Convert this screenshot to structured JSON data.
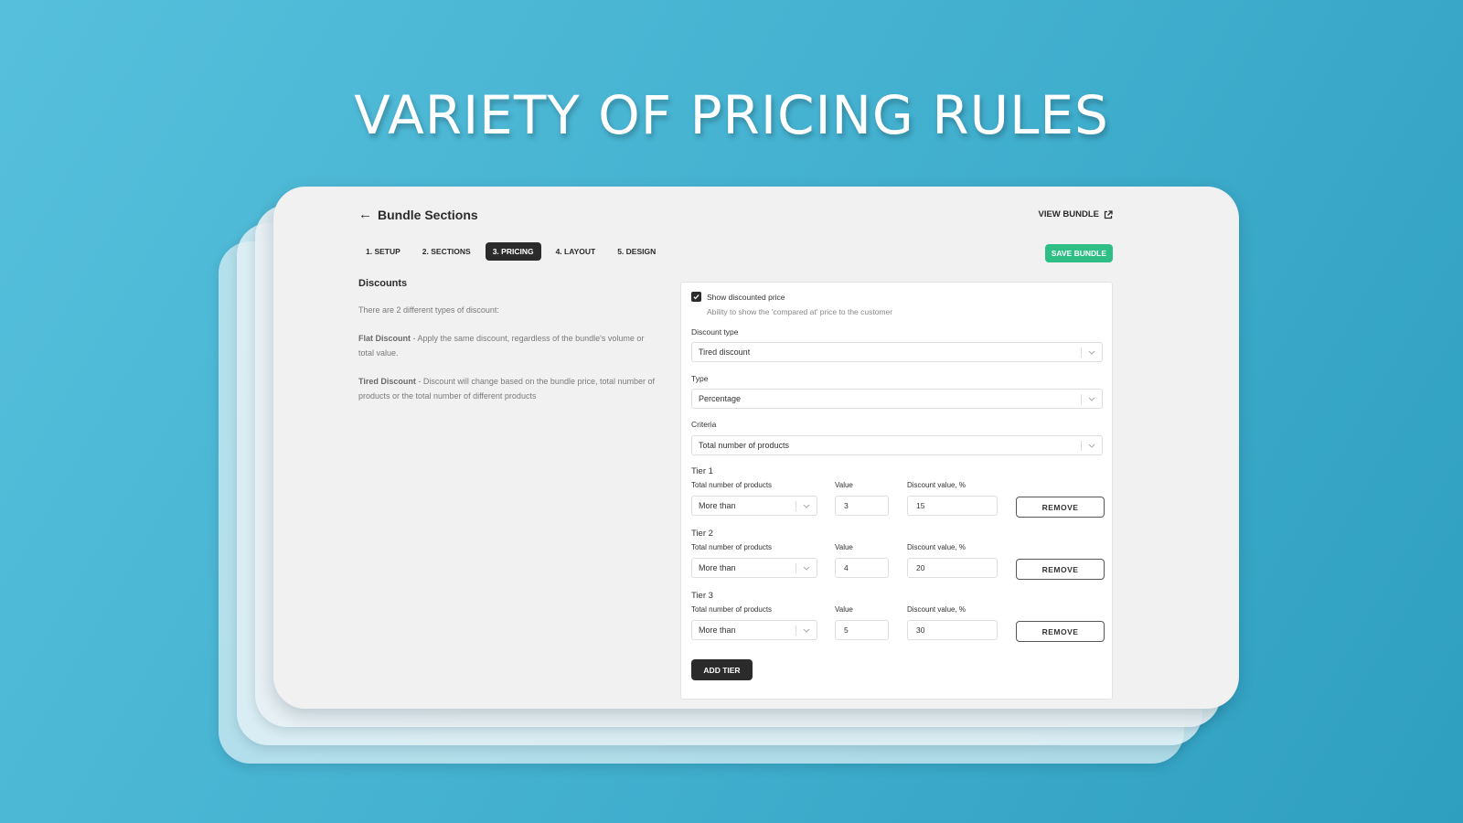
{
  "hero": {
    "title": "VARIETY OF PRICING RULES"
  },
  "header": {
    "back_icon": "arrow-left-icon",
    "title": "Bundle Sections",
    "view_bundle_label": "VIEW BUNDLE",
    "view_bundle_icon": "external-link-icon"
  },
  "tabs": [
    {
      "label": "1. SETUP",
      "active": false
    },
    {
      "label": "2. SECTIONS",
      "active": false
    },
    {
      "label": "3. PRICING",
      "active": true
    },
    {
      "label": "4. LAYOUT",
      "active": false
    },
    {
      "label": "5. DESIGN",
      "active": false
    }
  ],
  "save_label": "SAVE BUNDLE",
  "colors": {
    "save_button": "#2fbf86",
    "active_tab": "#2b2b2b",
    "background": "#45b2d1"
  },
  "info": {
    "heading": "Discounts",
    "intro": "There are 2 different types of discount:",
    "flat_title": "Flat Discount",
    "flat_text": " - Apply the same discount, regardless of the bundle's volume or total value.",
    "tiered_title": "Tired Discount",
    "tiered_text": " - Discount will change based on the bundle price, total number of products or the total number of different products"
  },
  "form": {
    "show_discounted": {
      "label": "Show discounted price",
      "help": "Ability to show the 'compared at' price to the customer",
      "checked": true
    },
    "discount_type": {
      "label": "Discount type",
      "value": "Tired discount"
    },
    "type": {
      "label": "Type",
      "value": "Percentage"
    },
    "criteria": {
      "label": "Criteria",
      "value": "Total number of products"
    },
    "tiers": [
      {
        "title": "Tier 1",
        "criteria_label": "Total number of products",
        "operator": "More than",
        "value_label": "Value",
        "value": "3",
        "discount_label": "Discount value, %",
        "discount": "15",
        "remove_label": "REMOVE"
      },
      {
        "title": "Tier 2",
        "criteria_label": "Total number of products",
        "operator": "More than",
        "value_label": "Value",
        "value": "4",
        "discount_label": "Discount value, %",
        "discount": "20",
        "remove_label": "REMOVE"
      },
      {
        "title": "Tier 3",
        "criteria_label": "Total number of products",
        "operator": "More than",
        "value_label": "Value",
        "value": "5",
        "discount_label": "Discount value, %",
        "discount": "30",
        "remove_label": "REMOVE"
      }
    ],
    "add_tier_label": "ADD TIER"
  }
}
